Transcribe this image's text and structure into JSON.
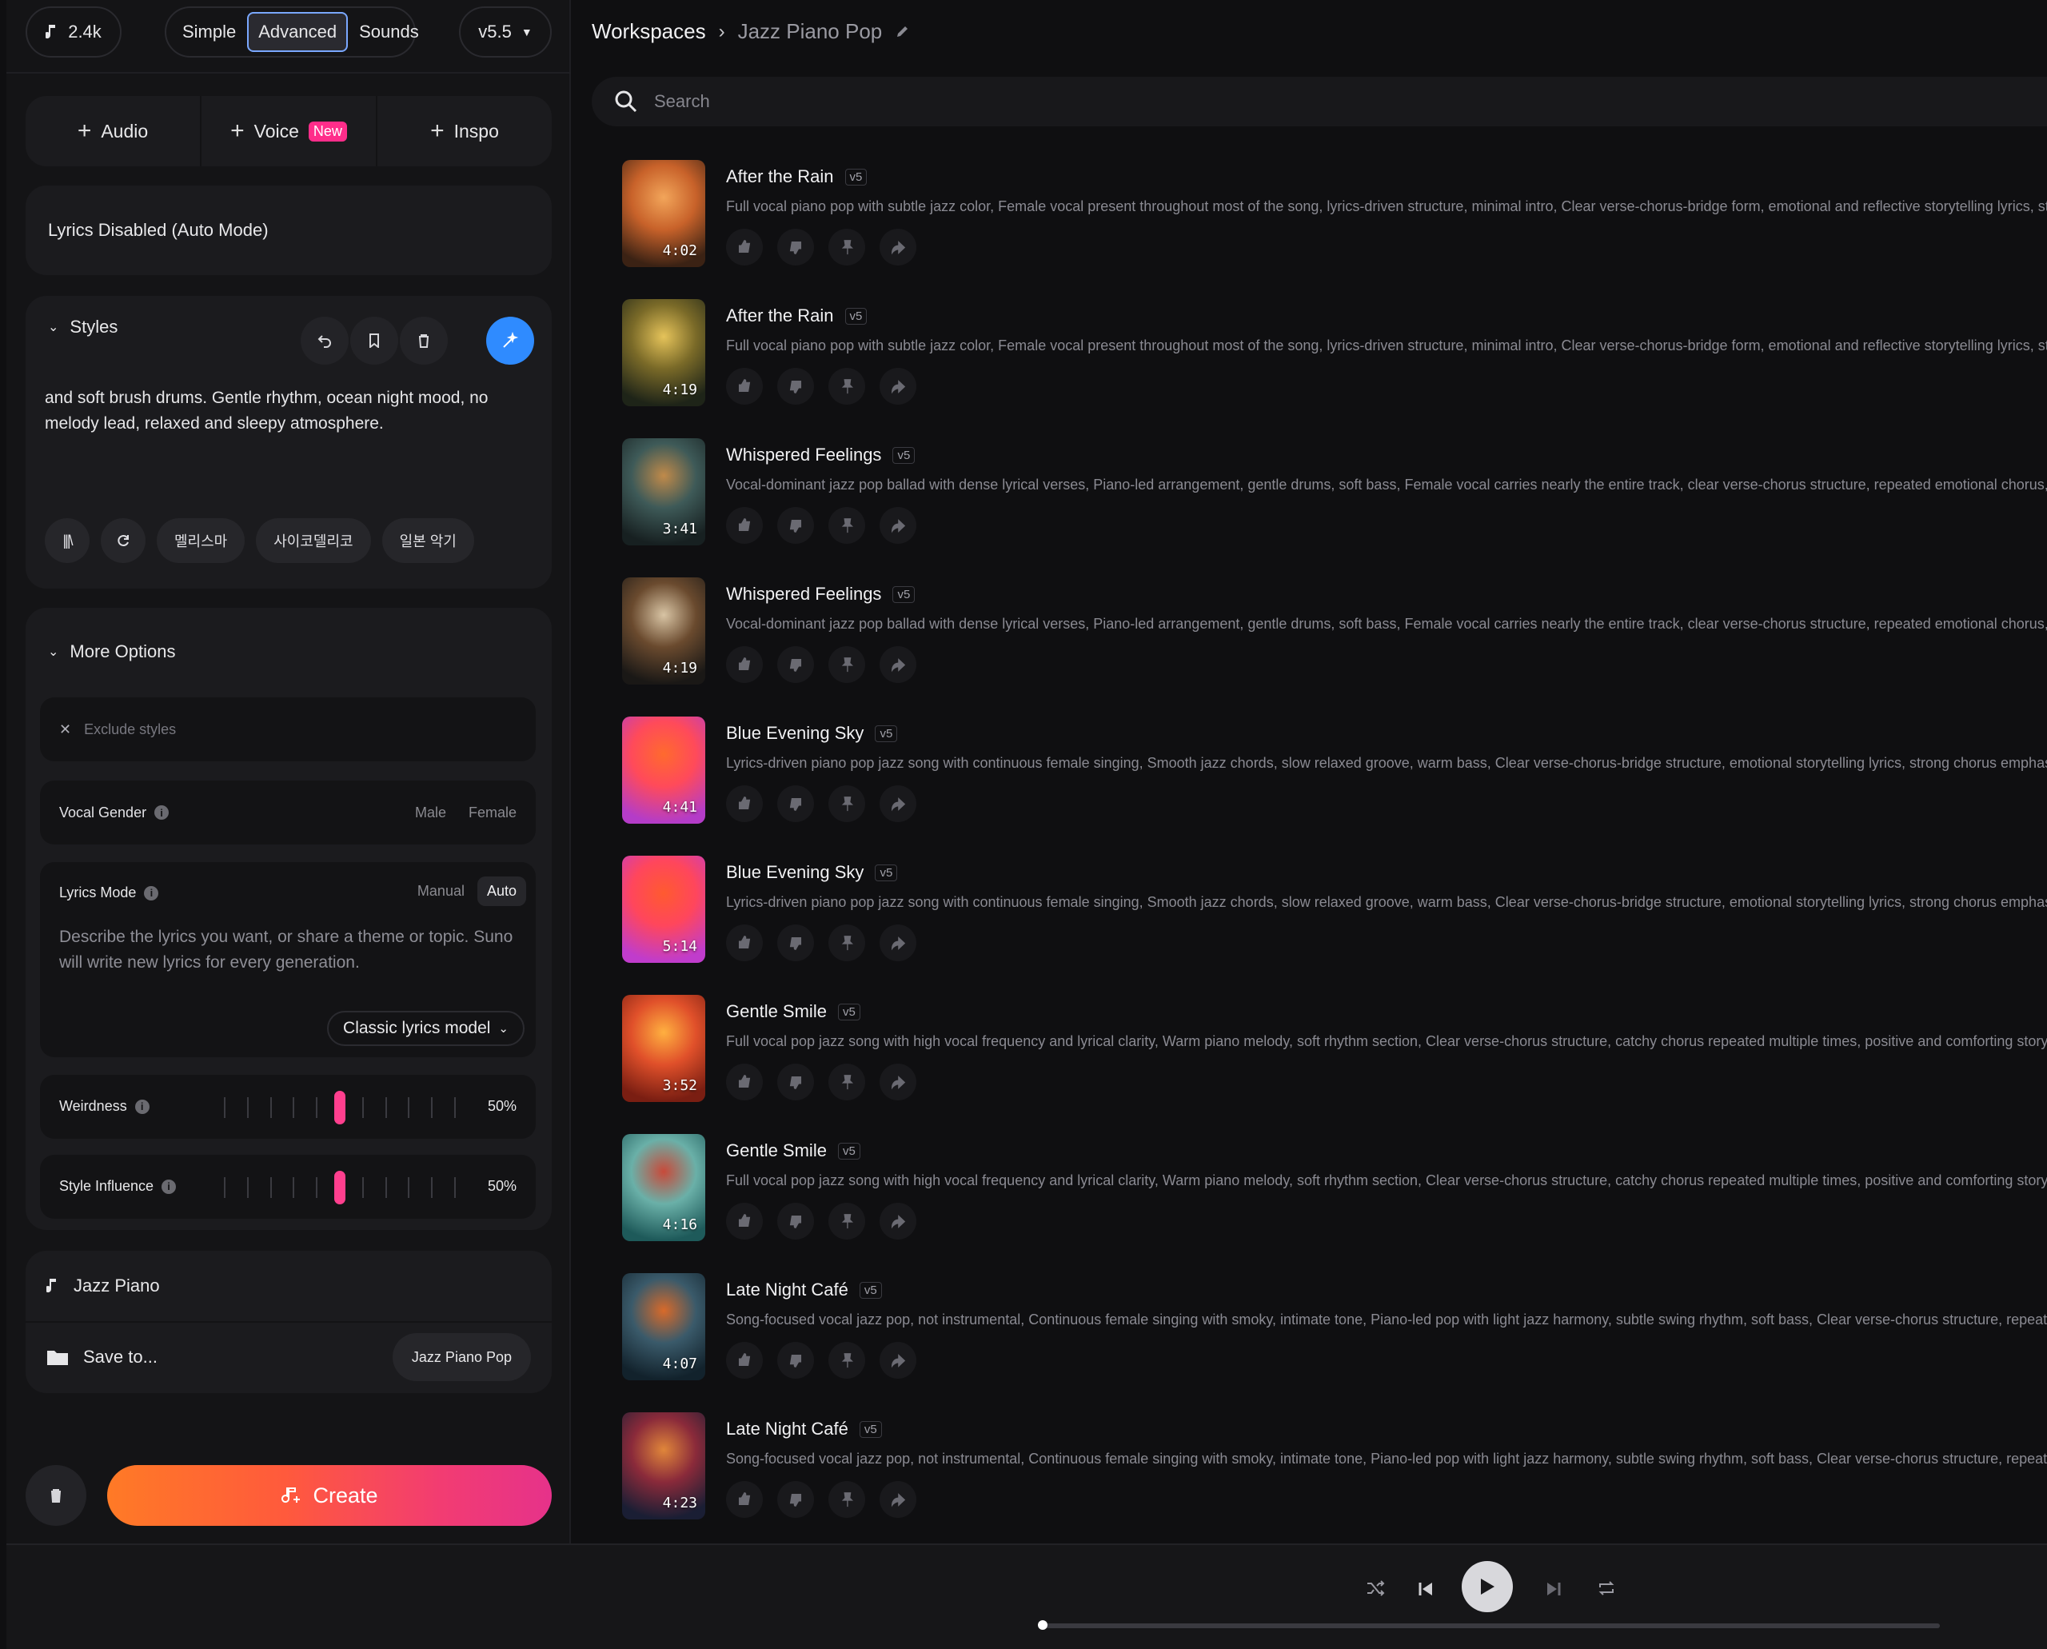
{
  "topbar": {
    "credits": "2.4k",
    "modes": [
      "Simple",
      "Advanced",
      "Sounds"
    ],
    "active_mode": "Advanced",
    "version": "v5.5"
  },
  "add_buttons": {
    "audio": "Audio",
    "voice": "Voice",
    "voice_badge": "New",
    "inspo": "Inspo"
  },
  "lyrics_box": "Lyrics Disabled (Auto Mode)",
  "styles": {
    "header": "Styles",
    "text": "and soft brush drums. Gentle rhythm, ocean night mood, no melody lead, relaxed and sleepy atmosphere.",
    "chips": [
      "멜리스마",
      "사이코델리코",
      "일본 악기"
    ]
  },
  "more_options": {
    "header": "More Options",
    "exclude_placeholder": "Exclude styles",
    "vocal_gender": {
      "label": "Vocal Gender",
      "options": [
        "Male",
        "Female"
      ]
    },
    "lyrics_mode": {
      "label": "Lyrics Mode",
      "options": [
        "Manual",
        "Auto"
      ],
      "selected": "Auto",
      "placeholder": "Describe the lyrics you want, or share a theme or topic. Suno will write new lyrics for every generation.",
      "model": "Classic lyrics model"
    },
    "weirdness": {
      "label": "Weirdness",
      "value_text": "50%",
      "value": 0.5
    },
    "style_influence": {
      "label": "Style Influence",
      "value_text": "50%",
      "value": 0.5
    }
  },
  "bottom": {
    "title": "Jazz Piano",
    "save_to": "Save to...",
    "workspace_chip": "Jazz Piano Pop"
  },
  "create_label": "Create",
  "breadcrumb": {
    "root": "Workspaces",
    "current": "Jazz Piano Pop"
  },
  "search_placeholder": "Search",
  "songs": [
    {
      "title": "After the Rain",
      "version": "v5",
      "duration": "4:02",
      "desc": "Full vocal piano pop with subtle jazz color, Female vocal present throughout most of the song, lyrics-driven structure, minimal intro, Clear verse-chorus-bridge form, emotional and reflective storytelling lyrics, str",
      "colors": [
        "#3b2214",
        "#c8622a",
        "#f2a55a"
      ]
    },
    {
      "title": "After the Rain",
      "version": "v5",
      "duration": "4:19",
      "desc": "Full vocal piano pop with subtle jazz color, Female vocal present throughout most of the song, lyrics-driven structure, minimal intro, Clear verse-chorus-bridge form, emotional and reflective storytelling lyrics, str",
      "colors": [
        "#1e2418",
        "#7a6a28",
        "#e5c35a"
      ]
    },
    {
      "title": "Whispered Feelings",
      "version": "v5",
      "duration": "3:41",
      "desc": "Vocal-dominant jazz pop ballad with dense lyrical verses, Piano-led arrangement, gentle drums, soft bass, Female vocal carries nearly the entire track, clear verse-chorus structure, repeated emotional chorus, i",
      "colors": [
        "#172021",
        "#3e5a58",
        "#c08a4a"
      ]
    },
    {
      "title": "Whispered Feelings",
      "version": "v5",
      "duration": "4:19",
      "desc": "Vocal-dominant jazz pop ballad with dense lyrical verses, Piano-led arrangement, gentle drums, soft bass, Female vocal carries nearly the entire track, clear verse-chorus structure, repeated emotional chorus, i",
      "colors": [
        "#1a1816",
        "#6a4a2e",
        "#d8c4a4"
      ]
    },
    {
      "title": "Blue Evening Sky",
      "version": "v5",
      "duration": "4:41",
      "desc": "Lyrics-driven piano pop jazz song with continuous female singing, Smooth jazz chords, slow relaxed groove, warm bass, Clear verse-chorus-bridge structure, emotional storytelling lyrics, strong chorus emphas",
      "colors": [
        "#b43cc8",
        "#ff4a5a",
        "#ff6a2e"
      ]
    },
    {
      "title": "Blue Evening Sky",
      "version": "v5",
      "duration": "5:14",
      "desc": "Lyrics-driven piano pop jazz song with continuous female singing, Smooth jazz chords, slow relaxed groove, warm bass, Clear verse-chorus-bridge structure, emotional storytelling lyrics, strong chorus emphas",
      "colors": [
        "#c03ccc",
        "#ff465c",
        "#ff5a30"
      ]
    },
    {
      "title": "Gentle Smile",
      "version": "v5",
      "duration": "3:52",
      "desc": "Full vocal pop jazz song with high vocal frequency and lyrical clarity, Warm piano melody, soft rhythm section, Clear verse-chorus structure, catchy chorus repeated multiple times, positive and comforting storyt",
      "colors": [
        "#7a1e12",
        "#e0502a",
        "#ffb040"
      ]
    },
    {
      "title": "Gentle Smile",
      "version": "v5",
      "duration": "4:16",
      "desc": "Full vocal pop jazz song with high vocal frequency and lyrical clarity, Warm piano melody, soft rhythm section, Clear verse-chorus structure, catchy chorus repeated multiple times, positive and comforting storyt",
      "colors": [
        "#1e5a5a",
        "#6ab0a8",
        "#c84a3a"
      ]
    },
    {
      "title": "Late Night Café",
      "version": "v5",
      "duration": "4:07",
      "desc": "Song-focused vocal jazz pop, not instrumental, Continuous female singing with smoky, intimate tone, Piano-led pop with light jazz harmony, subtle swing rhythm, soft bass, Clear verse-chorus structure, repeated",
      "colors": [
        "#12222c",
        "#3a5a6a",
        "#d86a2a"
      ]
    },
    {
      "title": "Late Night Café",
      "version": "v5",
      "duration": "4:23",
      "desc": "Song-focused vocal jazz pop, not instrumental, Continuous female singing with smoky, intimate tone, Piano-led pop with light jazz harmony, subtle swing rhythm, soft bass, Clear verse-chorus structure, repeated",
      "colors": [
        "#1a1e34",
        "#8a2a3a",
        "#e0863a"
      ]
    }
  ],
  "player": {
    "progress": 0.0
  }
}
